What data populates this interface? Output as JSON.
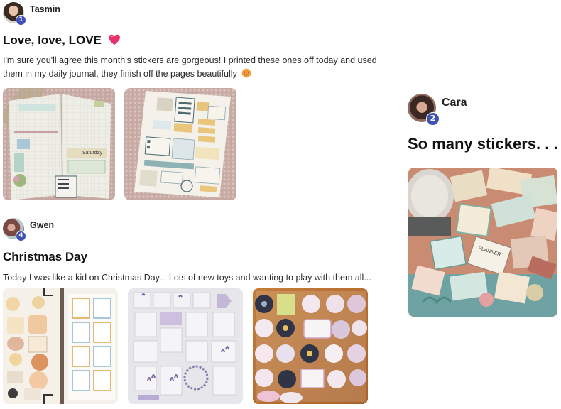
{
  "posts": [
    {
      "author": "Tasmin",
      "badge": "1",
      "title": "Love, love, LOVE",
      "title_icon": "heart-icon",
      "text_line1": "I'm sure you'll agree this month's stickers are gorgeous! I printed these ones off today and used",
      "text_line2": "them in my daily journal, they finish off the pages beautifully",
      "text_icon": "smiling-face-with-heart-eyes-icon",
      "photos": [
        {
          "name": "journal-spread-photo",
          "text": "Saturday"
        },
        {
          "name": "sticker-sheet-photo",
          "text": ""
        }
      ]
    },
    {
      "author": "Gwen",
      "badge": "4",
      "title": "Christmas Day",
      "text": "Today I was like a kid on Christmas Day... Lots of new toys and wanting to play with them all...",
      "photos": [
        {
          "name": "cat-sticker-sheets-photo"
        },
        {
          "name": "lavender-sticker-sheet-photo"
        },
        {
          "name": "round-animal-stickers-photo"
        }
      ]
    },
    {
      "author": "Cara",
      "badge": "2",
      "title": "So many stickers. . .",
      "photos": [
        {
          "name": "sticker-pile-photo",
          "text": "PLANNER"
        }
      ]
    }
  ],
  "colors": {
    "badge": "#3f51b5",
    "heart": "#e8336a",
    "table_bg": "#c7a9a4"
  }
}
